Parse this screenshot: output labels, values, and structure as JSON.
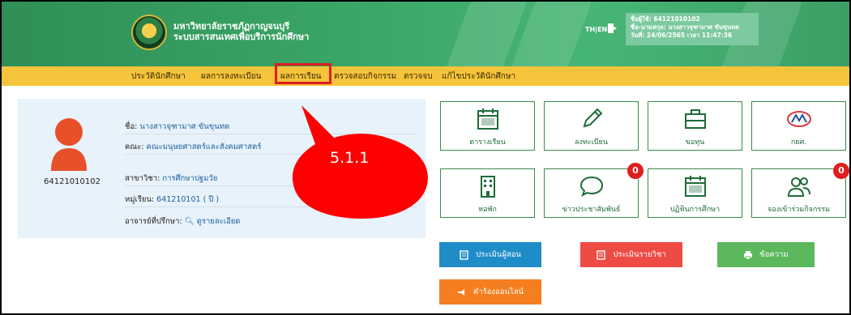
{
  "header": {
    "university_name": "มหาวิทยาลัยราชภัฏกาญจนบุรี",
    "system_name": "ระบบสารสนเทศเพื่อบริการนักศึกษา",
    "lang_label": "TH|EN",
    "user_lines": [
      "ชื่อผู้ใช้: 64121010102",
      "ชื่อ-นามสกุล: นางสาวจุฑามาศ ขันขุนทด",
      "วันที่: 24/06/2565 เวลา 11:47:36"
    ]
  },
  "menu": {
    "items": [
      "ประวัตินักศึกษา",
      "ผลการลงทะเบียน",
      "ผลการเรียน",
      "ตรวจสอบกิจกรรม",
      "ตรวจจบ",
      "แก้ไขประวัตินักศึกษา"
    ]
  },
  "callout": {
    "label": "5.1.1"
  },
  "profile": {
    "student_id": "64121010102",
    "rows": [
      {
        "label": "ชื่อ:",
        "value": "นางสาวจุฑามาศ ขันขุนทด"
      },
      {
        "label": "คณะ:",
        "value": "คณะมนุษยศาสตร์และสังคมศาสตร์"
      },
      {
        "label": "สาขาวิชา:",
        "value": "การศึกษาปฐมวัย"
      },
      {
        "label": "หมู่เรียน:",
        "value": "641210101 ( ปี )"
      },
      {
        "label": "อาจารย์ที่ปรึกษา:",
        "value": "ดูรายละเอียด"
      }
    ]
  },
  "tiles": [
    {
      "label": "ตารางเรียน",
      "icon": "calendar-icon"
    },
    {
      "label": "ลงทะเบียน",
      "icon": "pencil-icon"
    },
    {
      "label": "ขอทุน",
      "icon": "briefcase-icon"
    },
    {
      "label": "กยศ.",
      "icon": "student-loan-fund-logo"
    },
    {
      "label": "หอพัก",
      "icon": "building-icon"
    },
    {
      "label": "ข่าวประชาสัมพันธ์",
      "icon": "speech-bubble-icon",
      "badge": "0"
    },
    {
      "label": "ปฏิทินการศึกษา",
      "icon": "calendar-icon"
    },
    {
      "label": "จองเข้าร่วมกิจกรรม",
      "icon": "users-icon",
      "badge": "0"
    }
  ],
  "buttons": {
    "evaluate_teacher": "ประเมินผู้สอน",
    "evaluate_course": "ประเมินรายวิชา",
    "messages": "ข้อความ",
    "online_request": "คำร้องออนไลน์"
  },
  "colors": {
    "header_green": "#3aa566",
    "menu_yellow": "#f6c43a",
    "tile_border": "#3a8a47",
    "btn_blue": "#1e8cc7",
    "btn_red": "#ef4b45",
    "btn_green": "#5cb85c",
    "btn_orange": "#f57f20",
    "highlight_red": "#e11d1d"
  }
}
